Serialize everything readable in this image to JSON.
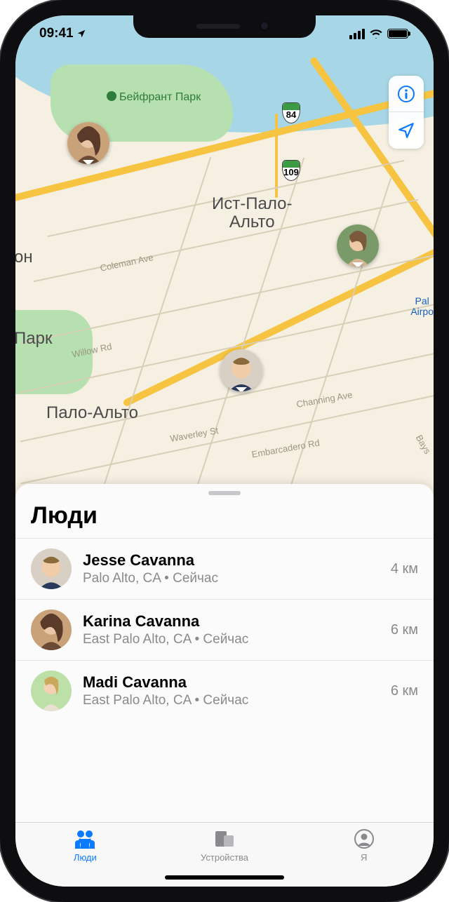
{
  "status_bar": {
    "time": "09:41"
  },
  "map": {
    "park_label": "Бейфрант Парк",
    "city_center": "Ист-Пало-\nАльто",
    "city_left_cut": "он",
    "city_park_cut": "Парк",
    "city_bottom": "Пало-Альто",
    "shield_84": "84",
    "shield_109": "109",
    "poi_airport_1": "Pal",
    "poi_airport_2": "Airpo",
    "streets": {
      "coleman": "Coleman Ave",
      "willow": "Willow Rd",
      "waverley": "Waverley St",
      "channing": "Channing Ave",
      "embarcadero": "Embarcadero Rd",
      "bays": "Bays"
    }
  },
  "sheet": {
    "title": "Люди",
    "people": [
      {
        "name": "Jesse Cavanna",
        "location": "Palo Alto, CA • Сейчас",
        "distance": "4 км"
      },
      {
        "name": "Karina Cavanna",
        "location": "East Palo Alto, CA • Сейчас",
        "distance": "6 км"
      },
      {
        "name": "Madi Cavanna",
        "location": "East Palo Alto, CA • Сейчас",
        "distance": "6 км"
      }
    ]
  },
  "tabs": {
    "people": "Люди",
    "devices": "Устройства",
    "me": "Я"
  }
}
